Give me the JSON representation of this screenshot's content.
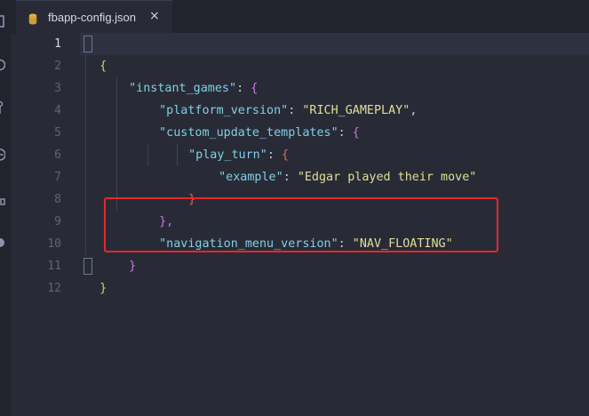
{
  "tab": {
    "filename": "fbapp-config.json",
    "close_glyph": "×",
    "icon": "database-icon"
  },
  "activity_bar": {
    "icons": [
      "files-icon",
      "search-icon",
      "source-control-icon",
      "debug-icon",
      "extensions-icon",
      "remote-icon"
    ]
  },
  "editor": {
    "active_line": 1,
    "line_numbers": [
      "1",
      "2",
      "3",
      "4",
      "5",
      "6",
      "7",
      "8",
      "9",
      "10",
      "11",
      "12"
    ],
    "lines": [
      {
        "key": "",
        "value": ""
      },
      {
        "key": "\"instant_games\"",
        "value": ""
      },
      {
        "key": "\"platform_version\"",
        "value": "\"RICH_GAMEPLAY\""
      },
      {
        "key": "\"custom_update_templates\"",
        "value": ""
      },
      {
        "key": "\"play_turn\"",
        "value": ""
      },
      {
        "key": "\"example\"",
        "value": "\"Edgar played their move\""
      },
      {
        "key": "",
        "value": ""
      },
      {
        "key": "",
        "value": ""
      },
      {
        "key": "\"navigation_menu_version\"",
        "value": "\"NAV_FLOATING\""
      },
      {
        "key": "",
        "value": ""
      },
      {
        "key": "",
        "value": ""
      },
      {
        "key": "",
        "value": ""
      }
    ],
    "punctuation": {
      "open_brace": "{",
      "close_brace": "}",
      "colon": ": ",
      "comma": ",",
      "close_brace_comma": "},"
    }
  },
  "colors": {
    "background": "#282b36",
    "key": "#7fd0e6",
    "string": "#e3de94",
    "highlight_box": "#e8262b"
  }
}
